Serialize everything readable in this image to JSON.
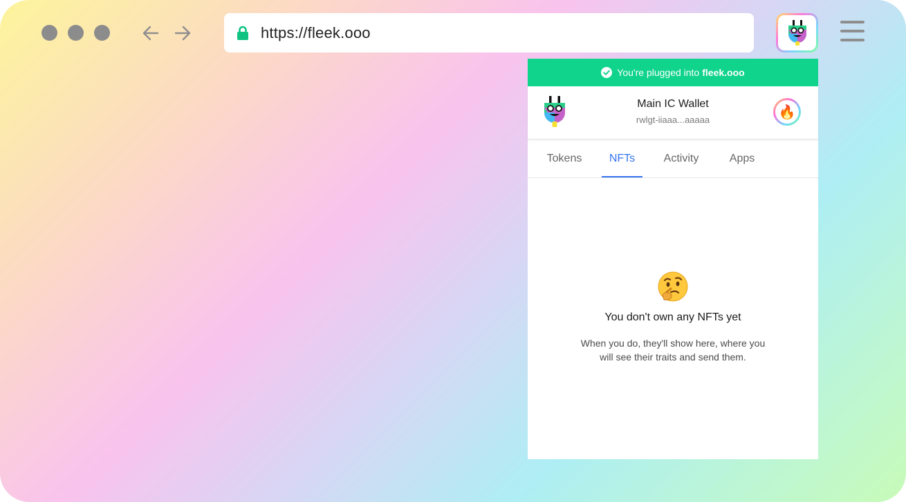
{
  "browser": {
    "url": "https://fleek.ooo",
    "icons": {
      "window_dots": "traffic-light-dots",
      "back": "arrow-left-icon",
      "forward": "arrow-right-icon",
      "lock": "lock-icon",
      "extension": "plug-extension-icon",
      "menu": "hamburger-menu-icon"
    }
  },
  "popup": {
    "banner": {
      "prefix": "You're plugged into",
      "site": "fleek.ooo",
      "color": "#10d38c"
    },
    "wallet": {
      "name": "Main IC Wallet",
      "address": "rwlgt-iiaaa...aaaaa",
      "badge_icon": "fire-emoji"
    },
    "tabs": [
      "Tokens",
      "NFTs",
      "Activity",
      "Apps"
    ],
    "active_tab": "NFTs",
    "accent_color": "#3574f0",
    "empty_state": {
      "icon": "thinking-face-emoji",
      "title": "You don't own any NFTs yet",
      "description": "When you do, they'll show here, where you will see their traits and send them."
    }
  }
}
